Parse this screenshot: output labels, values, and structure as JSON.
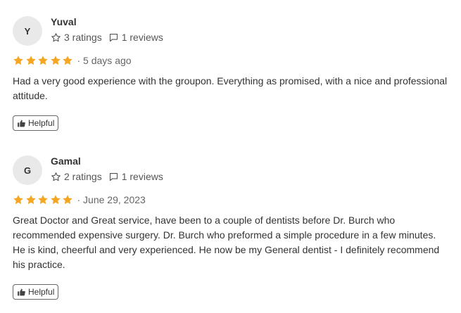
{
  "colors": {
    "star": "#f5a623",
    "avatar_bg": "#e9e9ea",
    "text": "#333333",
    "muted": "#666666"
  },
  "icons": {
    "rating": "star-outline-icon",
    "reviews": "speech-bubble-icon",
    "helpful": "thumbs-up-icon",
    "star": "star-icon"
  },
  "reviews": [
    {
      "initial": "Y",
      "name": "Yuval",
      "ratings": "3 ratings",
      "reviews": "1 reviews",
      "stars": 5,
      "date": "· 5 days ago",
      "text": "Had a very good experience with the groupon. Everything as promised, with a nice and professional attitude.",
      "helpful_label": "Helpful"
    },
    {
      "initial": "G",
      "name": "Gamal",
      "ratings": "2 ratings",
      "reviews": "1 reviews",
      "stars": 5,
      "date": "· June 29, 2023",
      "text": "Great Doctor and Great service, have been to a couple of dentists before Dr. Burch who recommended expensive surgery. Dr. Burch who preformed a simple procedure in a few minutes. He is kind, cheerful and very experienced. He now be my General dentist - I definitely recommend his practice.",
      "helpful_label": "Helpful"
    }
  ]
}
